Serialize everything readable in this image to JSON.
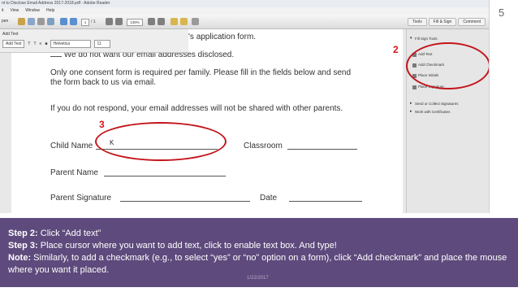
{
  "window": {
    "title": "nt to Disclose Email Address 2017-2018.pdf - Adobe Reader"
  },
  "menu": [
    "it",
    "View",
    "Window",
    "Help"
  ],
  "toolbar": {
    "open_label": "pen",
    "page_current": "1",
    "page_total": "/ 1",
    "zoom": "139%",
    "tab_tools": "Tools",
    "tab_fill_sign": "Fill & Sign",
    "tab_comment": "Comment"
  },
  "add_text_panel": {
    "title": "Add Text",
    "add_text_btn": "Add Text",
    "font": "Helvetica",
    "size": "11"
  },
  "document": {
    "line_application": "'s application form.",
    "line_no_disclose": "We do not want our email addresses disclosed.",
    "para1_line1": "Only one consent form is required per family.  Please fill in the fields below and send",
    "para1_line2": "the form back to us via email.",
    "para2": "If you do not respond, your email addresses will not be shared with other parents.",
    "child_name_label": "Child Name",
    "child_name_value": "K",
    "classroom_label": "Classroom",
    "parent_name_label": "Parent Name",
    "parent_signature_label": "Parent Signature",
    "date_label": "Date"
  },
  "sidebar": {
    "section1": "Fill Sign Tools",
    "items": [
      "Add Text",
      "Add Checkmark",
      "Place Initials",
      "Place Signature"
    ],
    "section2": "Send or Collect Signatures",
    "section3": "Work with Certificates"
  },
  "annotations": {
    "step2": "2",
    "step3": "3"
  },
  "slide": {
    "number": "5"
  },
  "caption": {
    "step2_label": "Step 2:",
    "step2_text": " Click “Add text”",
    "step3_label": "Step 3:",
    "step3_text": " Place cursor where you want to add text, click  to enable text box. And type!",
    "note_label": "Note:",
    "note_text": " Similarly, to add a checkmark (e.g., to select “yes” or “no” option on a form), click “Add checkmark” and place the mouse where you want it placed.",
    "watermark": "1/22/2017"
  },
  "colors": {
    "caption_bg": "#5e4a7c",
    "annotation_red": "#c2151b"
  }
}
